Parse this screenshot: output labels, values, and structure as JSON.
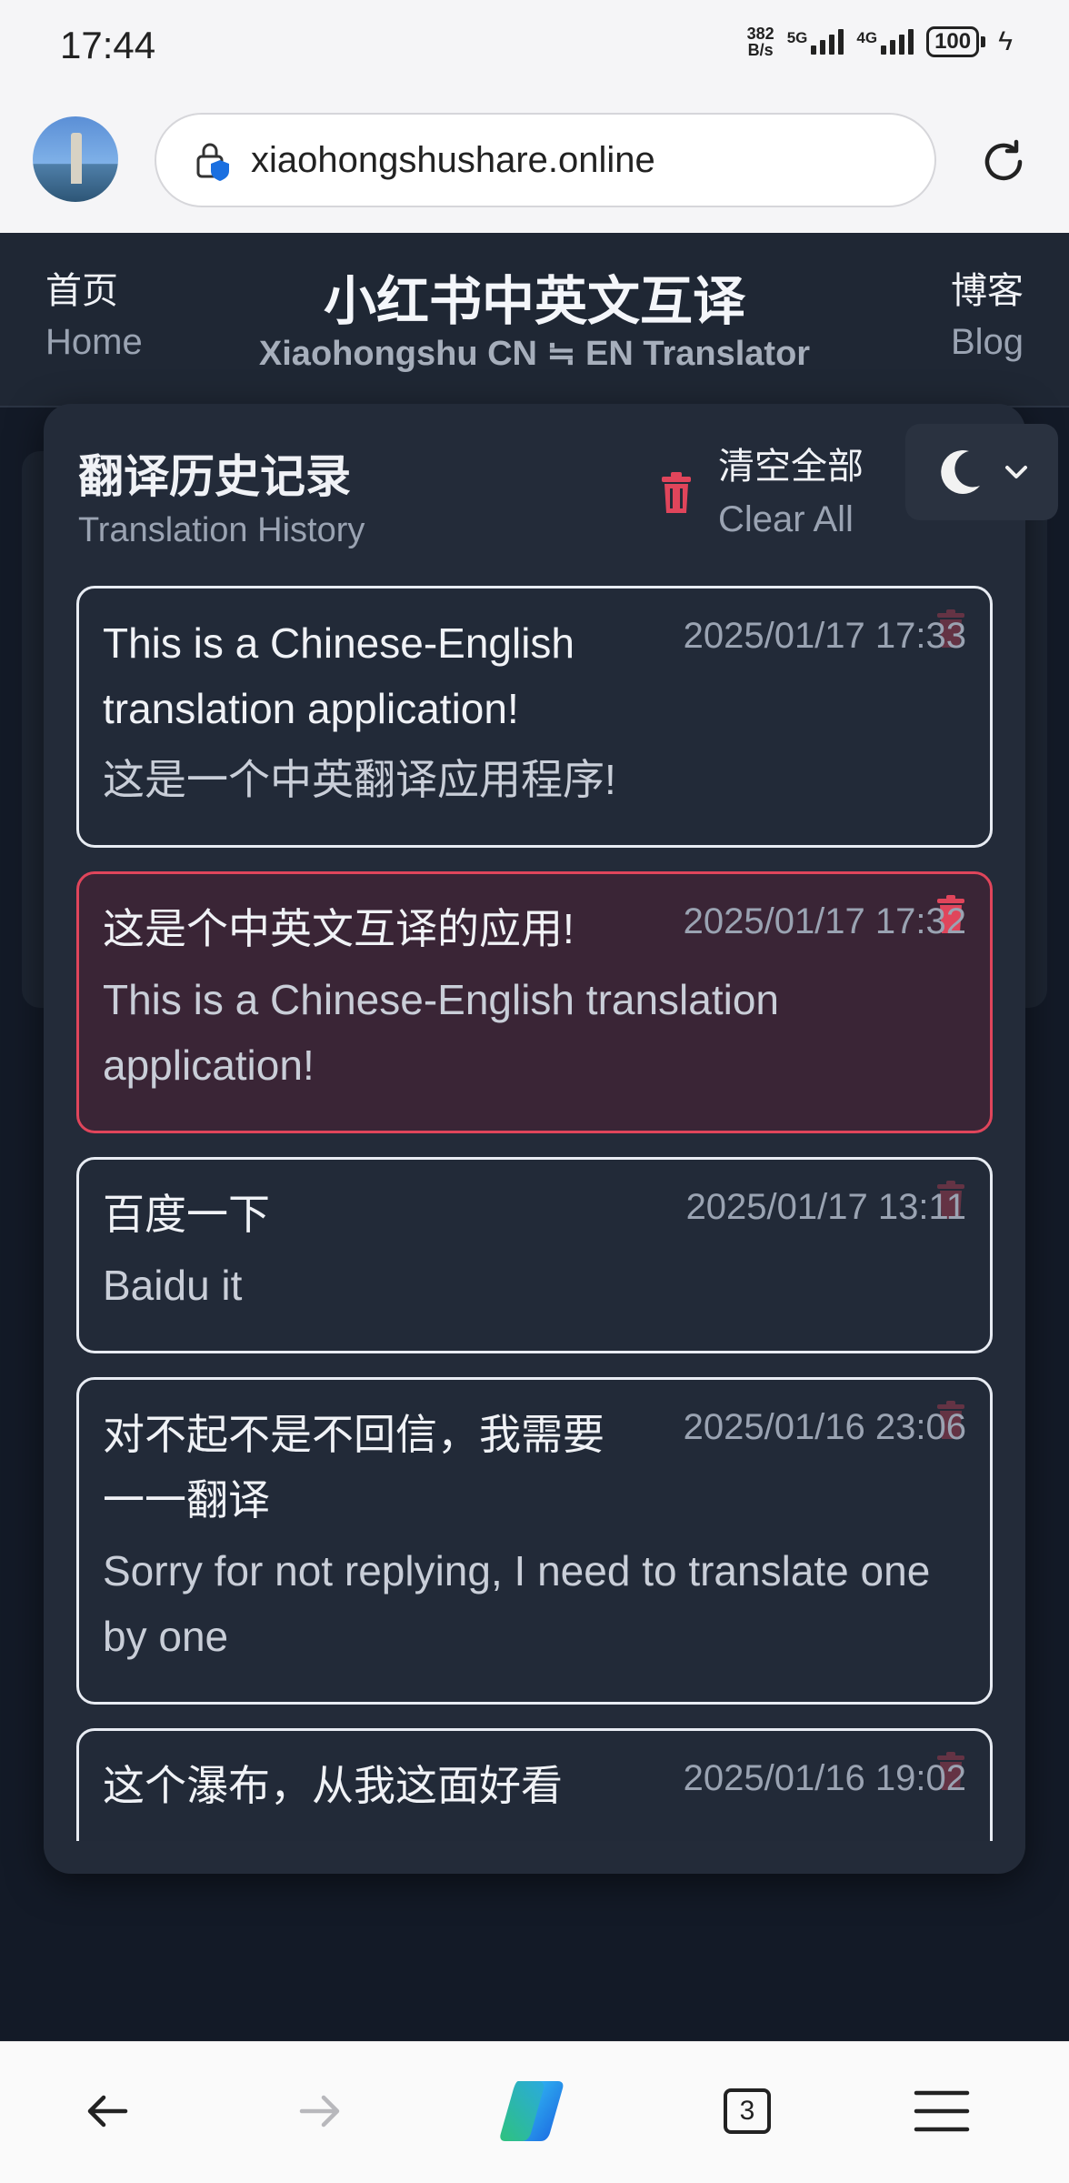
{
  "status_bar": {
    "time": "17:44",
    "net_speed_value": "382",
    "net_speed_unit": "B/s",
    "signal_1": "5G",
    "signal_2": "4G",
    "battery": "100"
  },
  "browser": {
    "url": "xiaohongshushare.online",
    "tab_count": "3"
  },
  "site": {
    "nav_home_zh": "首页",
    "nav_home_en": "Home",
    "title": "小红书中英文互译",
    "subtitle": "Xiaohongshu CN ≒ EN Translator",
    "nav_blog_zh": "博客",
    "nav_blog_en": "Blog"
  },
  "history": {
    "title": "翻译历史记录",
    "subtitle": "Translation History",
    "clear_zh": "清空全部",
    "clear_en": "Clear All",
    "items": [
      {
        "source": "This is a Chinese-English translation application!",
        "translation": "这是一个中英翻译应用程序!",
        "time": "2025/01/17 17:33",
        "active": false
      },
      {
        "source": "这是个中英文互译的应用!",
        "translation": "This is a Chinese-English translation application!",
        "time": "2025/01/17 17:32",
        "active": true
      },
      {
        "source": "百度一下",
        "translation": "Baidu it",
        "time": "2025/01/17 13:11",
        "active": false
      },
      {
        "source": "对不起不是不回信，我需要一一翻译",
        "translation": "Sorry for not replying, I need to translate one by one",
        "time": "2025/01/16 23:06",
        "active": false
      },
      {
        "source": "这个瀑布，从我这面好看",
        "translation": "",
        "time": "2025/01/16 19:02",
        "active": false
      }
    ]
  },
  "colors": {
    "accent_red": "#e0455b",
    "panel_bg": "#232b39",
    "page_bg": "#131a27"
  }
}
